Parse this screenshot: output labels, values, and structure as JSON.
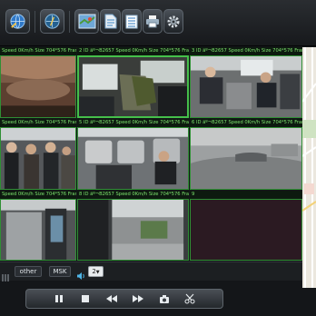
{
  "toolbar": {
    "buttons": [
      {
        "icon": "globe-connect-icon"
      },
      {
        "icon": "compass-icon"
      },
      {
        "icon": "map-icon"
      },
      {
        "icon": "document-icon"
      },
      {
        "icon": "list-icon"
      },
      {
        "icon": "printer-icon"
      },
      {
        "icon": "gear-icon"
      }
    ]
  },
  "cells": [
    {
      "header": "Speed  0Km/h  Size 704*576  Frame"
    },
    {
      "header": "2  ID äº¬B2657  Speed  0Km/h  Size 704*576  Frame"
    },
    {
      "header": "3  ID äº¬B2657  Speed  0Km/h  Size 704*576  Frame"
    },
    {
      "header": "Speed  0Km/h  Size 704*576  Frame"
    },
    {
      "header": "5  ID äº¬B2657  Speed  0Km/h  Size 704*576  Frame"
    },
    {
      "header": "6  ID äº¬B2657  Speed  0Km/h  Size 704*576  Frame"
    },
    {
      "header": "Speed  0Km/h  Size 704*576  Frame"
    },
    {
      "header": "8  ID äº¬B2657  Speed  0Km/h  Size 704*576  Frame"
    },
    {
      "header": "9"
    }
  ],
  "status": {
    "other_label": "other",
    "msk_label": "MSK",
    "volume_value": "2"
  },
  "playback": {
    "buttons": [
      "pause-icon",
      "stop-icon",
      "rewind-icon",
      "fast-forward-icon",
      "snapshot-icon",
      "scissors-icon"
    ]
  },
  "colors": {
    "header_text": "#7de36e",
    "cell_border": "#2f8f34",
    "selected_border": "#45c04a"
  }
}
